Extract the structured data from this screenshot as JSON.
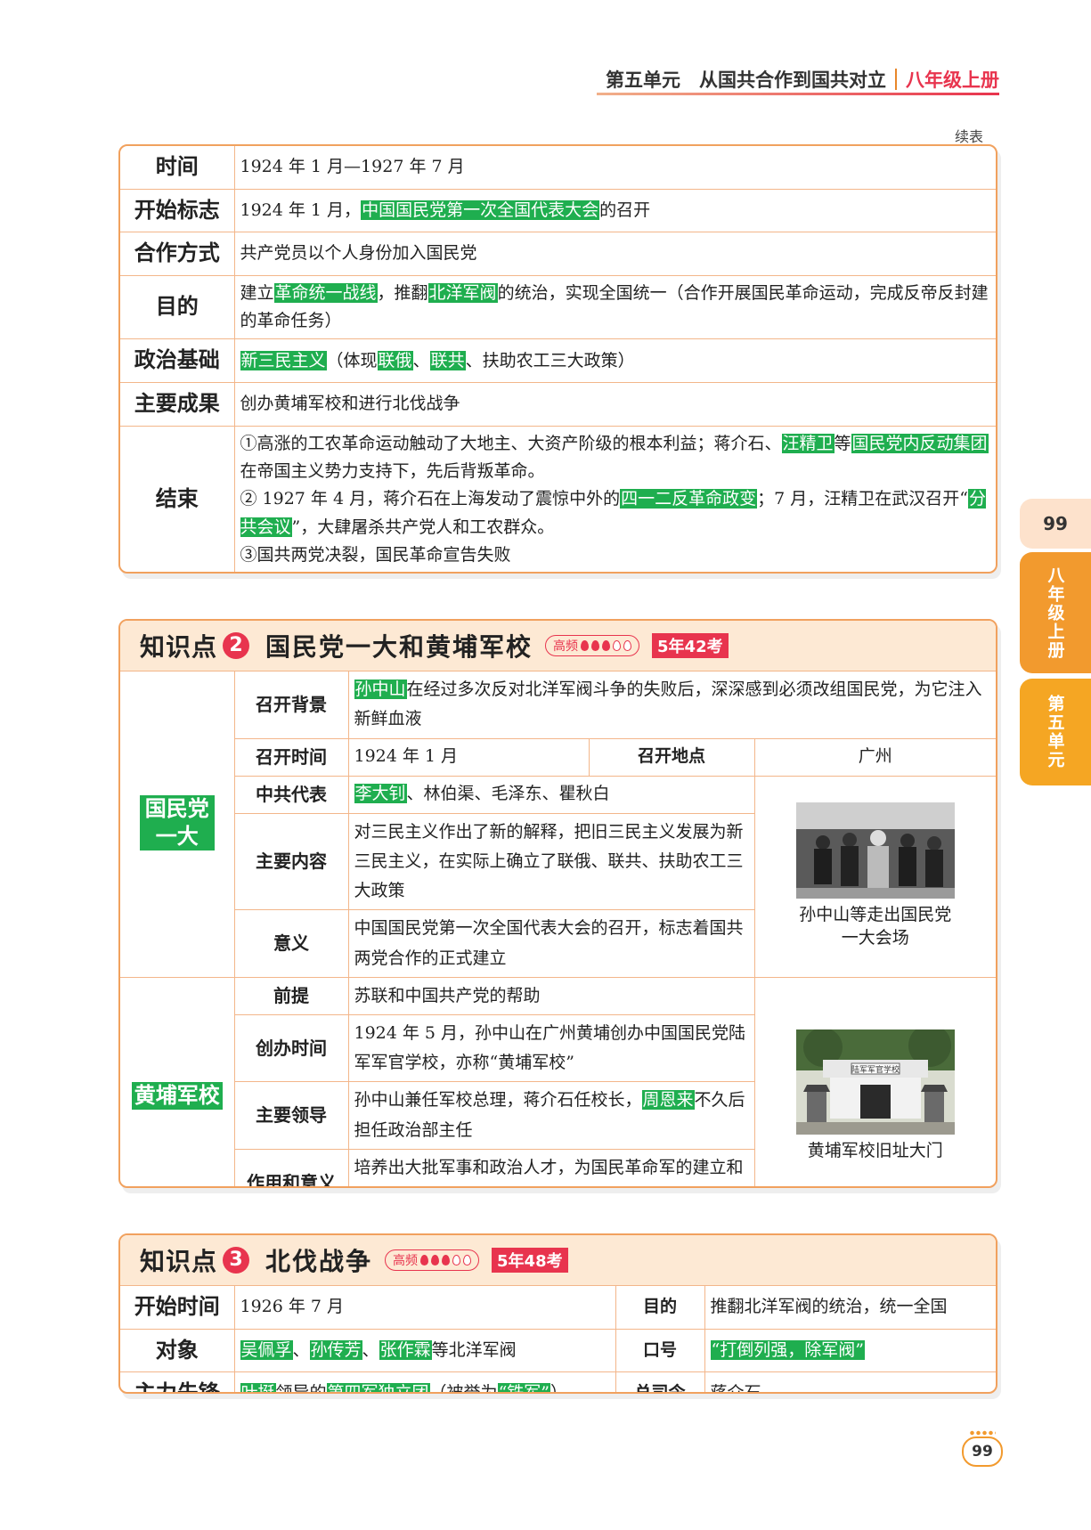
{
  "header": {
    "unit": "第五单元　从国共合作到国共对立",
    "grade": "八年级上册"
  },
  "continued_label": "续表",
  "table1": {
    "rows": [
      {
        "label": "时间",
        "parts": [
          {
            "t": "1924 年 1 月—1927 年 7 月"
          }
        ]
      },
      {
        "label": "开始标志",
        "parts": [
          {
            "t": "1924 年 1 月，"
          },
          {
            "t": "中国国民党第一次全国代表大会",
            "h": true
          },
          {
            "t": "的召开"
          }
        ]
      },
      {
        "label": "合作方式",
        "parts": [
          {
            "t": "共产党员以个人身份加入国民党"
          }
        ]
      },
      {
        "label": "目的",
        "parts": [
          {
            "t": "建立"
          },
          {
            "t": "革命统一战线",
            "h": true
          },
          {
            "t": "，推翻"
          },
          {
            "t": "北洋军阀",
            "h": true
          },
          {
            "t": "的统治，实现全国统一（合作开展国民革命运动，完成反帝反封建的革命任务）"
          }
        ]
      },
      {
        "label": "政治基础",
        "parts": [
          {
            "t": "新三民主义",
            "h": true
          },
          {
            "t": "（体现"
          },
          {
            "t": "联俄",
            "h": true
          },
          {
            "t": "、"
          },
          {
            "t": "联共",
            "h": true
          },
          {
            "t": "、扶助农工三大政策）"
          }
        ]
      },
      {
        "label": "主要成果",
        "parts": [
          {
            "t": "创办黄埔军校和进行北伐战争"
          }
        ]
      },
      {
        "label": "结束",
        "lines": [
          [
            {
              "t": "①高涨的工农革命运动触动了大地主、大资产阶级的根本利益；蒋介石、"
            },
            {
              "t": "汪精卫",
              "h": true
            },
            {
              "t": "等"
            },
            {
              "t": "国民党内反动集团",
              "h": true
            },
            {
              "t": "在帝国主义势力支持下，先后背叛革命。"
            }
          ],
          [
            {
              "t": "② 1927 年 4 月，蒋介石在上海发动了震惊中外的"
            },
            {
              "t": "四一二反革命政变",
              "h": true
            },
            {
              "t": "；7 月，汪精卫在武汉召开“"
            },
            {
              "t": "分共会议",
              "h": true
            },
            {
              "t": "”，大肆屠杀共产党人和工农群众。"
            }
          ],
          [
            {
              "t": "③国共两党决裂，国民革命宣告失败"
            }
          ]
        ]
      }
    ]
  },
  "kp2": {
    "title": "知识点",
    "num": "2",
    "name": "国民党一大和黄埔军校",
    "freq": "高频",
    "exam": "5年42考",
    "group1": "国民党一大",
    "group2": "黄埔军校",
    "rows": {
      "bg_label": "召开背景",
      "bg": [
        {
          "t": "孙中山",
          "h": true
        },
        {
          "t": "在经过多次反对北洋军阀斗争的失败后，深深感到必须改组国民党，为它注入新鲜血液"
        }
      ],
      "time_label": "召开时间",
      "time": "1924 年 1 月",
      "place_label": "召开地点",
      "place": "广州",
      "rep_label": "中共代表",
      "rep": [
        {
          "t": "李大钊",
          "h": true
        },
        {
          "t": "、林伯渠、毛泽东、瞿秋白"
        }
      ],
      "content_label": "主要内容",
      "content": "对三民主义作出了新的解释，把旧三民主义发展为新三民主义，在实际上确立了联俄、联共、扶助农工三大政策",
      "meaning_label": "意义",
      "meaning": "中国国民党第一次全国代表大会的召开，标志着国共两党合作的正式建立",
      "photo1_caption": "孙中山等走出国民党一大会场",
      "pre_label": "前提",
      "pre": "苏联和中国共产党的帮助",
      "found_label": "创办时间",
      "found": "1924 年 5 月，孙中山在广州黄埔创办中国国民党陆军军官学校，亦称“黄埔军校”",
      "lead_label": "主要领导",
      "lead": [
        {
          "t": "孙中山兼任军校总理，蒋介石任校长，"
        },
        {
          "t": "周恩来",
          "h": true
        },
        {
          "t": "不久后担任政治部主任"
        }
      ],
      "effect_label": "作用和意义",
      "effect": "培养出大批军事和政治人才，为国民革命军的建立和随后的北伐战争作了准备",
      "photo2_caption": "黄埔军校旧址大门",
      "photo2_sign": "陆军军官学校"
    }
  },
  "kp3": {
    "title": "知识点",
    "num": "3",
    "name": "北伐战争",
    "freq": "高频",
    "exam": "5年48考",
    "rows": {
      "start_label": "开始时间",
      "start": "1926 年 7 月",
      "goal_label": "目的",
      "goal": "推翻北洋军阀的统治，统一全国",
      "target_label": "对象",
      "target": [
        {
          "t": "吴佩孚",
          "h": true
        },
        {
          "t": "、"
        },
        {
          "t": "孙传芳",
          "h": true
        },
        {
          "t": "、"
        },
        {
          "t": "张作霖",
          "h": true
        },
        {
          "t": "等北洋军阀"
        }
      ],
      "slogan_label": "口号",
      "slogan": "“打倒列强，除军阀”",
      "vanguard_label": "主力先锋",
      "vanguard": [
        {
          "t": "叶挺",
          "h": true
        },
        {
          "t": "领导的"
        },
        {
          "t": "第四军独立团",
          "h": true
        },
        {
          "t": "（被誉为"
        },
        {
          "t": "“铁军”",
          "h": true
        },
        {
          "t": "）"
        }
      ],
      "cmd_label": "总司令",
      "cmd": "蒋介石"
    }
  },
  "tabs": {
    "page": "99",
    "grade": "八年级上册",
    "unit": "第五单元"
  },
  "page_number": "99",
  "colors": {
    "highlight": "#1fae4f",
    "accent": "#e8344e",
    "border": "#f1a15e",
    "tab": "#f29a2e"
  }
}
